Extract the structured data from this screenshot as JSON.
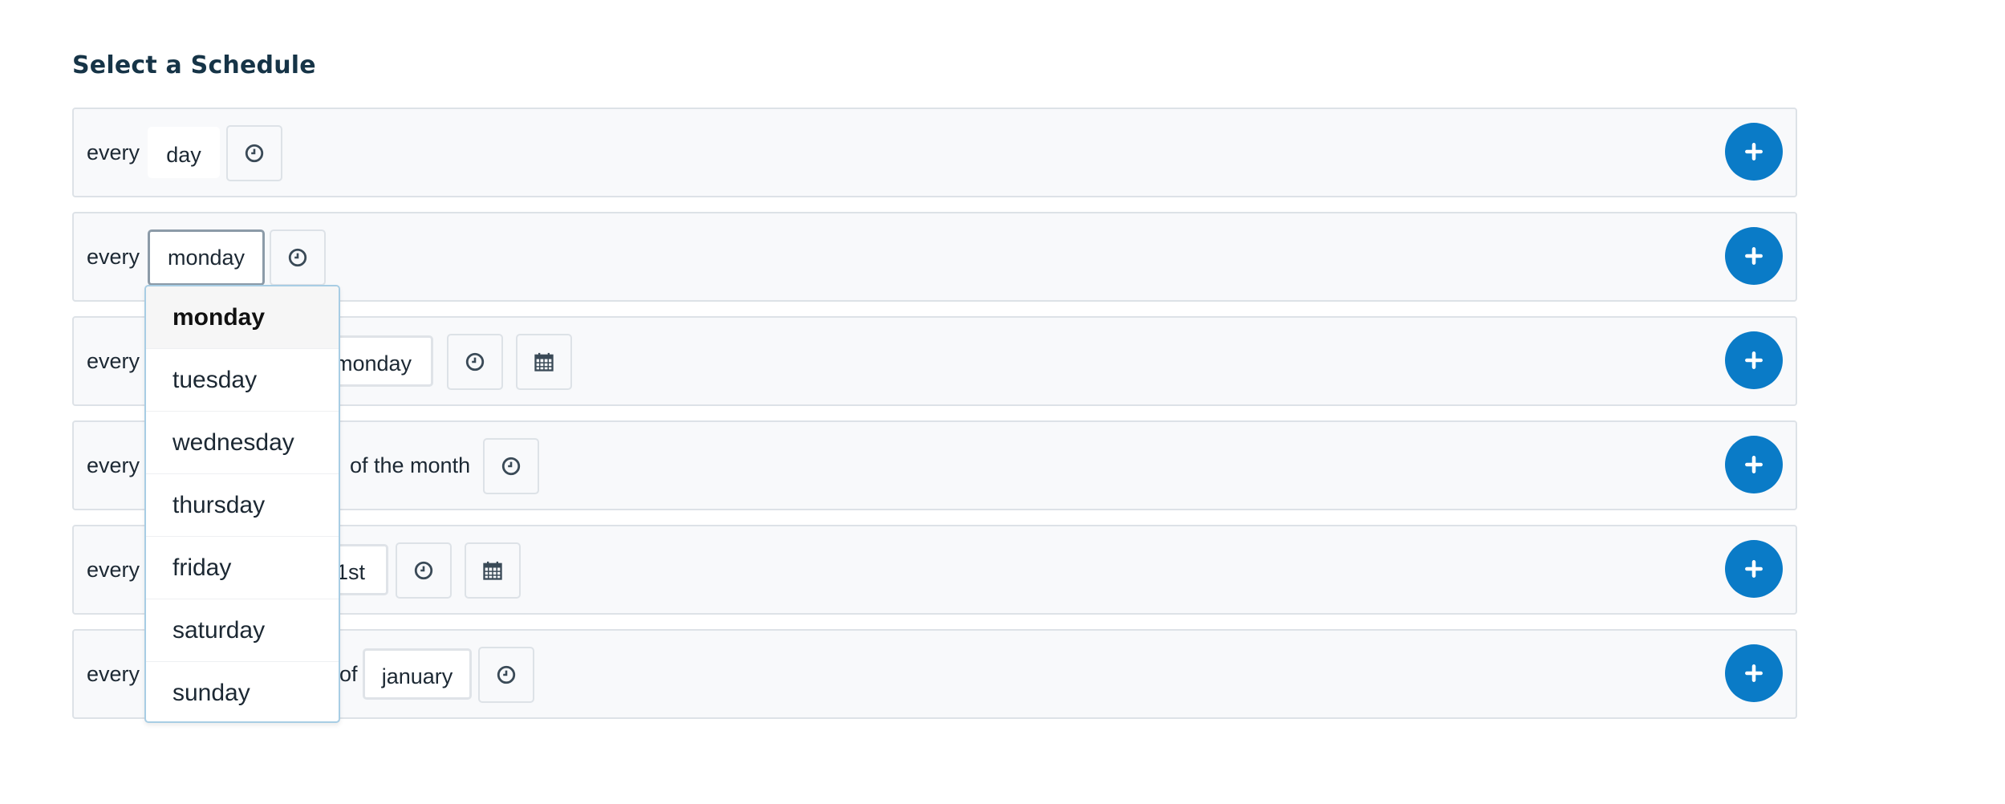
{
  "page": {
    "title": "Select a Schedule"
  },
  "rows": [
    {
      "every": "every",
      "period": "day"
    },
    {
      "every": "every",
      "weekday": "monday"
    },
    {
      "every": "every",
      "weekday": "monday"
    },
    {
      "every": "every",
      "connector": "of the month"
    },
    {
      "every": "every",
      "date": "1st"
    },
    {
      "every": "every",
      "connector": "of",
      "month": "january"
    }
  ],
  "dropdown": {
    "options": [
      "monday",
      "tuesday",
      "wednesday",
      "thursday",
      "friday",
      "saturday",
      "sunday"
    ],
    "selected": "monday"
  },
  "colors": {
    "accent": "#0a7bc7",
    "title": "#163447",
    "row_background": "#f8f9fb",
    "row_border": "#dde2e7",
    "dropdown_border": "#a8cde4"
  },
  "icons": {
    "time": "clock-icon",
    "calendar": "calendar-icon",
    "add": "plus-icon"
  }
}
